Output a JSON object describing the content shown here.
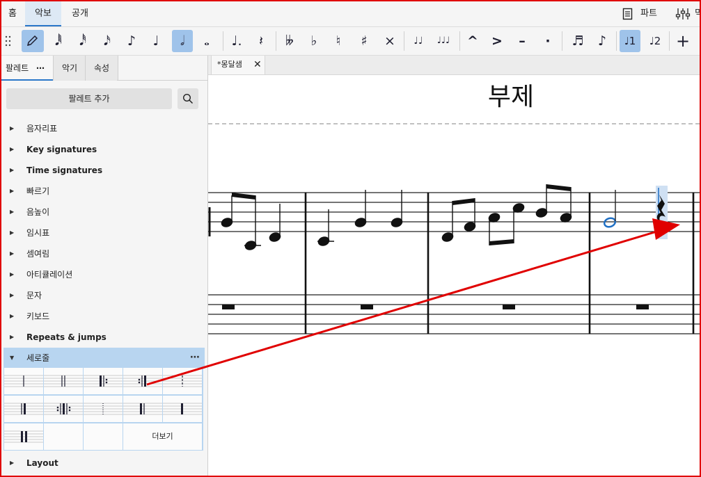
{
  "top_tabs": [
    {
      "label": "홈"
    },
    {
      "label": "악보"
    },
    {
      "label": "공개"
    }
  ],
  "top_right": {
    "parts_label": "파트",
    "mixer_label": "믹"
  },
  "toolbar": {
    "items": [
      {
        "name": "note-input-pencil-icon",
        "glyph": "✎"
      },
      {
        "name": "64th-note-icon",
        "glyph": "𝅘𝅥𝅱"
      },
      {
        "name": "32nd-note-icon",
        "glyph": "𝅘𝅥𝅰"
      },
      {
        "name": "16th-note-icon",
        "glyph": "𝅘𝅥𝅯"
      },
      {
        "name": "eighth-note-icon",
        "glyph": "♪"
      },
      {
        "name": "quarter-note-icon",
        "glyph": "♩"
      },
      {
        "name": "half-note-icon",
        "glyph": "𝅗𝅥"
      },
      {
        "name": "whole-note-icon",
        "glyph": "𝅝"
      },
      {
        "name": "augmentation-dot-icon",
        "glyph": "♩."
      },
      {
        "name": "rest-icon",
        "glyph": "𝄽"
      },
      {
        "name": "double-flat-icon",
        "glyph": "𝄫"
      },
      {
        "name": "flat-icon",
        "glyph": "♭"
      },
      {
        "name": "natural-icon",
        "glyph": "♮"
      },
      {
        "name": "sharp-icon",
        "glyph": "♯"
      },
      {
        "name": "double-sharp-icon",
        "glyph": "×"
      },
      {
        "name": "tie-icon",
        "glyph": "♩♩"
      },
      {
        "name": "slur-icon",
        "glyph": "♩♩♩"
      },
      {
        "name": "marcato-icon",
        "glyph": "^"
      },
      {
        "name": "accent-icon",
        "glyph": ">"
      },
      {
        "name": "tenuto-icon",
        "glyph": "–"
      },
      {
        "name": "staccato-icon",
        "glyph": "·"
      },
      {
        "name": "tuplet-icon",
        "glyph": "♬"
      },
      {
        "name": "flip-direction-icon",
        "glyph": "♪"
      },
      {
        "name": "voice-1-icon",
        "glyph": "♩1"
      },
      {
        "name": "voice-2-icon",
        "glyph": "♩2"
      },
      {
        "name": "add-icon",
        "glyph": "+"
      }
    ]
  },
  "left_panel": {
    "tabs": [
      {
        "label": "팔레트"
      },
      {
        "label": "악기"
      },
      {
        "label": "속성"
      }
    ],
    "add_palette_label": "팔레트 추가",
    "palettes": [
      {
        "label": "음자리표",
        "bold": false
      },
      {
        "label": "Key signatures",
        "bold": true
      },
      {
        "label": "Time signatures",
        "bold": true
      },
      {
        "label": "빠르기",
        "bold": false
      },
      {
        "label": "음높이",
        "bold": false
      },
      {
        "label": "임시표",
        "bold": false
      },
      {
        "label": "셈여림",
        "bold": false
      },
      {
        "label": "아티큘레이션",
        "bold": false
      },
      {
        "label": "문자",
        "bold": false
      },
      {
        "label": "키보드",
        "bold": false
      },
      {
        "label": "Repeats & jumps",
        "bold": true
      }
    ],
    "expanded_palette": {
      "label": "세로줄",
      "more_label": "더보기"
    },
    "last_palette": {
      "label": "Layout"
    }
  },
  "document": {
    "tab_title": "*몽달샘",
    "subtitle": "부제"
  },
  "colors": {
    "accent": "#2a77c9",
    "selection": "#9fc3ea",
    "annotation_arrow": "#e00000",
    "selected_note": "#1f6fc4"
  }
}
